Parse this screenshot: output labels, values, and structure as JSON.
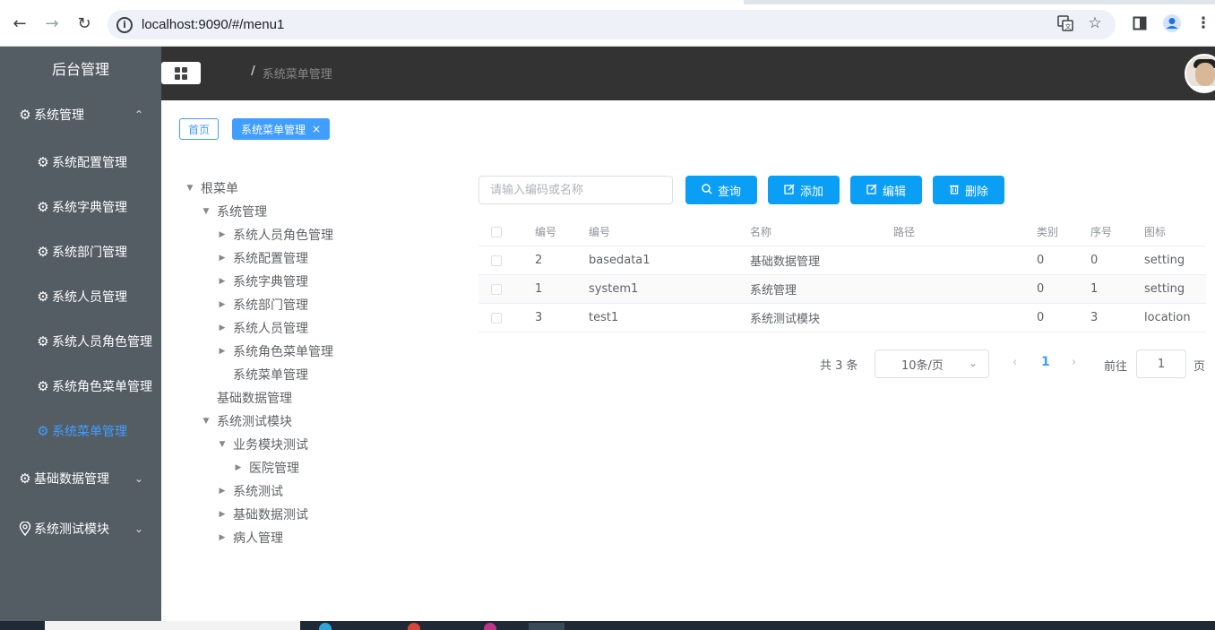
{
  "browser": {
    "url": "localhost:9090/#/menu1"
  },
  "sidebar": {
    "title": "后台管理",
    "groups": [
      {
        "label": "系统管理",
        "icon": "gear-icon",
        "expanded": true
      },
      {
        "label": "基础数据管理",
        "icon": "gear-icon",
        "expanded": false
      },
      {
        "label": "系统测试模块",
        "icon": "location-icon",
        "expanded": false
      }
    ],
    "sub_items": [
      {
        "label": "系统配置管理"
      },
      {
        "label": "系统字典管理"
      },
      {
        "label": "系统部门管理"
      },
      {
        "label": "系统人员管理"
      },
      {
        "label": "系统人员角色管理"
      },
      {
        "label": "系统角色菜单管理"
      },
      {
        "label": "系统菜单管理",
        "active": true
      }
    ]
  },
  "header": {
    "breadcrumb_sep": "/",
    "breadcrumb_current": "系统菜单管理"
  },
  "tags": {
    "home": "首页",
    "current": "系统菜单管理",
    "close": "×"
  },
  "tree": [
    {
      "label": "根菜单",
      "expanded": true
    },
    {
      "label": "系统管理",
      "expanded": true
    },
    {
      "label": "系统人员角色管理",
      "expanded": false
    },
    {
      "label": "系统配置管理",
      "expanded": false
    },
    {
      "label": "系统字典管理",
      "expanded": false
    },
    {
      "label": "系统部门管理",
      "expanded": false
    },
    {
      "label": "系统人员管理",
      "expanded": false
    },
    {
      "label": "系统角色菜单管理",
      "expanded": false
    },
    {
      "label": "系统菜单管理",
      "leaf": true
    },
    {
      "label": "基础数据管理",
      "leaf": true
    },
    {
      "label": "系统测试模块",
      "expanded": true
    },
    {
      "label": "业务模块测试",
      "expanded": true
    },
    {
      "label": "医院管理",
      "expanded": false
    },
    {
      "label": "系统测试",
      "expanded": false
    },
    {
      "label": "基础数据测试",
      "expanded": false
    },
    {
      "label": "病人管理",
      "expanded": false
    }
  ],
  "toolbar": {
    "search_placeholder": "请输入编码或名称",
    "query": "查询",
    "add": "添加",
    "edit": "编辑",
    "delete": "删除"
  },
  "table": {
    "headers": [
      "编号",
      "编号",
      "名称",
      "路径",
      "类别",
      "序号",
      "图标"
    ],
    "rows": [
      [
        "2",
        "basedata1",
        "基础数据管理",
        "",
        "0",
        "0",
        "setting"
      ],
      [
        "1",
        "system1",
        "系统管理",
        "",
        "0",
        "1",
        "setting"
      ],
      [
        "3",
        "test1",
        "系统测试模块",
        "",
        "0",
        "3",
        "location"
      ]
    ]
  },
  "pagination": {
    "total": "共 3 条",
    "page_size": "10条/页",
    "current_page": "1",
    "goto_label": "前往",
    "goto_value": "1",
    "goto_suffix": "页"
  }
}
